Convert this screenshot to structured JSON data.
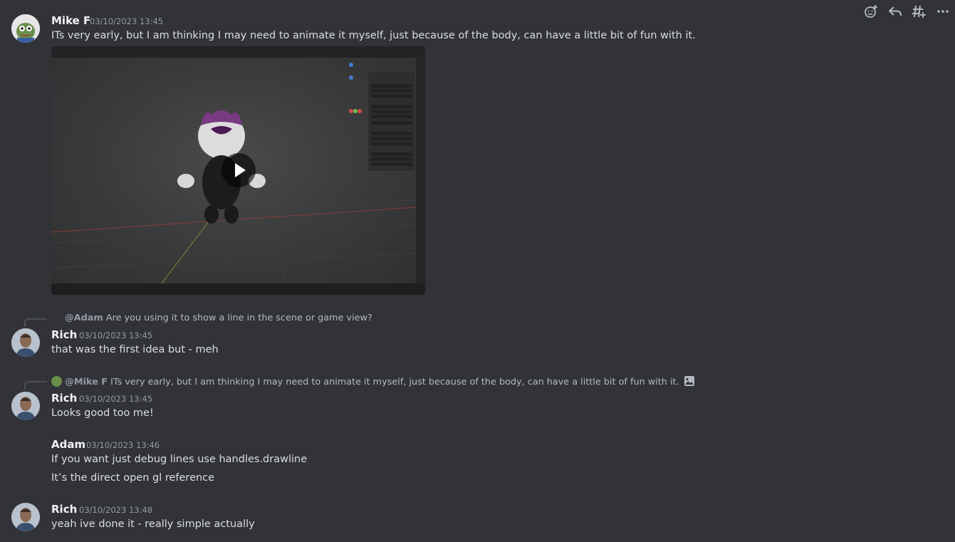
{
  "messages": [
    {
      "author": "Mike F",
      "timestamp": "03/10/2023 13:45",
      "text": "ITs very early, but I am thinking I may need to animate it myself, just because of the body, can have a little bit of fun with it.",
      "attachment": "blender-character-render"
    },
    {
      "reply_to": {
        "mention": "@Adam",
        "text": "Are you using it to show a line in the scene or game view?"
      },
      "author": "Rich",
      "timestamp": "03/10/2023 13:45",
      "text": "that was the first idea but - meh"
    },
    {
      "reply_to": {
        "mention": "@Mike F",
        "text": "ITs very early, but I am thinking I may need to animate it myself, just because of the body, can have a little bit of fun with it."
      },
      "author": "Rich",
      "timestamp": "03/10/2023 13:45",
      "text": "Looks good too me!"
    },
    {
      "author": "Adam",
      "timestamp": "03/10/2023 13:46",
      "lines": [
        "If you want just debug lines use handles.drawline",
        "It’s the direct open gl reference"
      ]
    },
    {
      "author": "Rich",
      "timestamp": "03/10/2023 13:48",
      "text": "yeah ive done it - really simple actually"
    }
  ],
  "hover_actions": [
    "add-reaction-icon",
    "reply-icon",
    "create-thread-icon",
    "more-icon"
  ],
  "colors": {
    "background": "#313338",
    "text": "#dbdee1",
    "muted": "#949ba4",
    "username": "#f2f3f5"
  }
}
